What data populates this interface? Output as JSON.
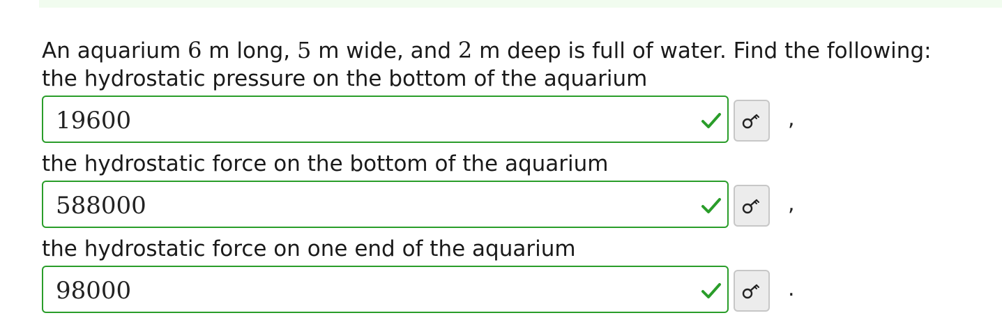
{
  "problem": {
    "intro_a": "An aquarium ",
    "length": "6",
    "intro_b": " m long, ",
    "width": "5",
    "intro_c": " m wide, and ",
    "depth": "2",
    "intro_d": " m deep is full of water. Find the following:"
  },
  "questions": [
    {
      "label": "the hydrostatic pressure on the bottom of the aquarium",
      "answer": "19600",
      "status": "correct",
      "punctuation": ","
    },
    {
      "label": "the hydrostatic force on the bottom of the aquarium",
      "answer": "588000",
      "status": "correct",
      "punctuation": ","
    },
    {
      "label": "the hydrostatic force on one end of the aquarium",
      "answer": "98000",
      "status": "correct",
      "punctuation": "."
    }
  ],
  "icons": {
    "correct": "checkmark-icon",
    "preview": "key-icon"
  },
  "colors": {
    "correct": "#2a9d2a",
    "banner": "#f1fcef",
    "button_bg": "#ececec"
  }
}
